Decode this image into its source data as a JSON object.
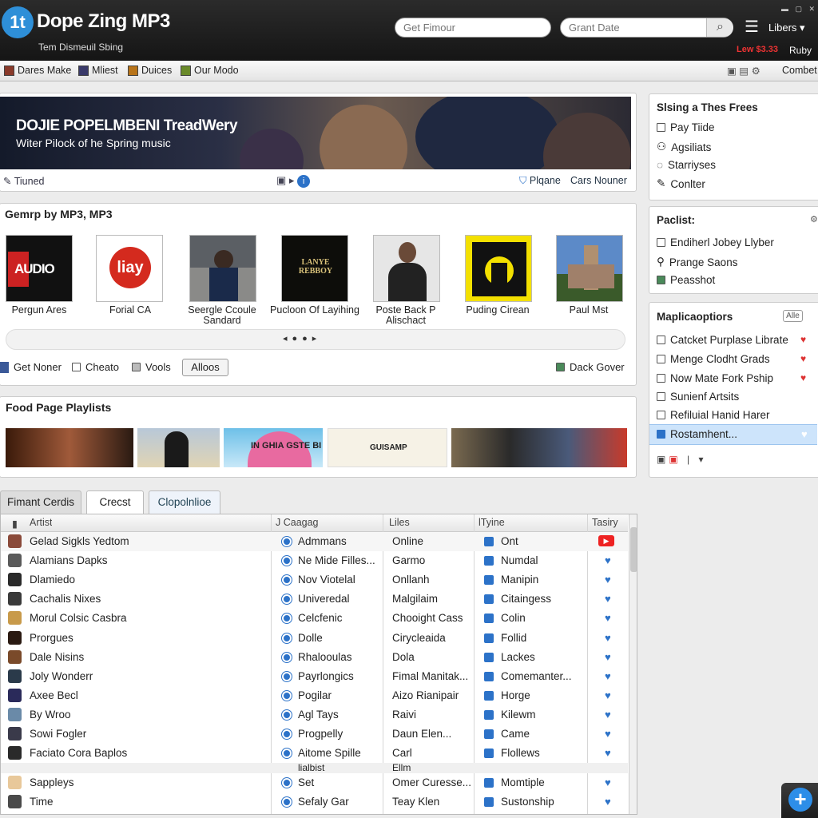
{
  "header": {
    "logo": "1t",
    "title": "Dope Zing MP3",
    "subtitle": "Tem Dismeuil Sbing",
    "search1_placeholder": "Get Fimour",
    "search2_placeholder": "Grant Date",
    "user": "Libers",
    "price": "Lew $3.33",
    "ruby": "Ruby"
  },
  "toolbar": {
    "items": [
      "Dares Make",
      "Mliest",
      "Duices",
      "Our Modo"
    ],
    "right": "Combet"
  },
  "banner": {
    "title": "DOJIE POPELMBENI TreadWery",
    "subtitle": "Witer Pilock of he Spring music",
    "tuned": "Tiuned",
    "plane": "Plqane",
    "cars": "Cars Nouner"
  },
  "genre": {
    "heading": "Gemrp by MP3, MP3",
    "albums": [
      {
        "label": "Pergun Ares",
        "art": "AUDIO"
      },
      {
        "label": "Forial CA",
        "art": "liay"
      },
      {
        "label": "Seergle Ccoule Sandard",
        "art": ""
      },
      {
        "label": "Pucloon Of Layihing",
        "art": "LANYE REBBOY"
      },
      {
        "label": "Poste Back P Alischact",
        "art": ""
      },
      {
        "label": "Puding Cirean",
        "art": ""
      },
      {
        "label": "Paul Mst",
        "art": ""
      }
    ],
    "actions": [
      "Get Noner",
      "Cheato",
      "Vools",
      "Alloos"
    ],
    "right_action": "Dack Gover"
  },
  "playlists": {
    "heading": "Food Page Playlists",
    "thumb_text": [
      "IN GHIA GSTE BI",
      "GUISAMP"
    ]
  },
  "tabs": [
    "Fimant Cerdis",
    "Crecst",
    "Clopolnlioe"
  ],
  "table": {
    "headers": [
      "Artist",
      "J Caagag",
      "Liles",
      "lTyine",
      "Tasiry"
    ],
    "rows": [
      [
        "Gelad Sigkls Yedtom",
        "Admmans",
        "Online",
        "Ont"
      ],
      [
        "Alamians Dapks",
        "Ne Mide Filles...",
        "Garmo",
        "Numdal"
      ],
      [
        "Dlamiedo",
        "Nov Viotelal",
        "Onllanh",
        "Manipin"
      ],
      [
        "Cachalis Nixes",
        "Univeredal",
        "Malgilaim",
        "Citaingess"
      ],
      [
        "Morul Colsic Casbra",
        "Celcfenic",
        "Chooight Cass",
        "Colin"
      ],
      [
        "Prorgues",
        "Dolle",
        "Cirycleaida",
        "Follid"
      ],
      [
        "Dale Nisins",
        "Rhalooulas",
        "Dola",
        "Lackes"
      ],
      [
        "Joly Wonderr",
        "Payrlongics",
        "Fimal Manitak...",
        "Comemanter..."
      ],
      [
        "Axee Becl",
        "Pogilar",
        "Aizo Rianipair",
        "Horge"
      ],
      [
        "By Wroo",
        "Agl Tays",
        "Raivi",
        "Kilewm"
      ],
      [
        "Sowi Fogler",
        "Progpelly",
        "Daun Elen...",
        "Came"
      ],
      [
        "Faciato Cora Baplos",
        "Aitome Spille",
        "Carl",
        "Flollews"
      ],
      [
        "",
        "lialbist",
        "Ellm",
        ""
      ],
      [
        "Sappleys",
        "Set",
        "Omer Curesse...",
        "Momtiple"
      ],
      [
        "Time",
        "Sefaly Gar",
        "Teay Klen",
        "Sustonship"
      ]
    ]
  },
  "sidebar": {
    "top_heading": "Slsing a Thes Frees",
    "top_items": [
      "Pay Tiide",
      "Agsiliats",
      "Starriyses",
      "Conlter"
    ],
    "playlist_heading": "Paclist:",
    "playlist_items": [
      "Endiherl Jobey Llyber",
      "Prange Saons",
      "Peasshot"
    ],
    "apps_heading": "Maplicaoptiors",
    "apps_badge": "Alle",
    "apps_items": [
      "Catcket Purplase Librate",
      "Menge Clodht Grads",
      "Now Mate Fork Pship",
      "Sunienf Artsits",
      "Refiluial Hanid Harer",
      "Rostamhent..."
    ]
  },
  "colors": {
    "accent": "#2c72c8",
    "header_bg": "#1c1c1c",
    "selected": "#cde4fb"
  }
}
